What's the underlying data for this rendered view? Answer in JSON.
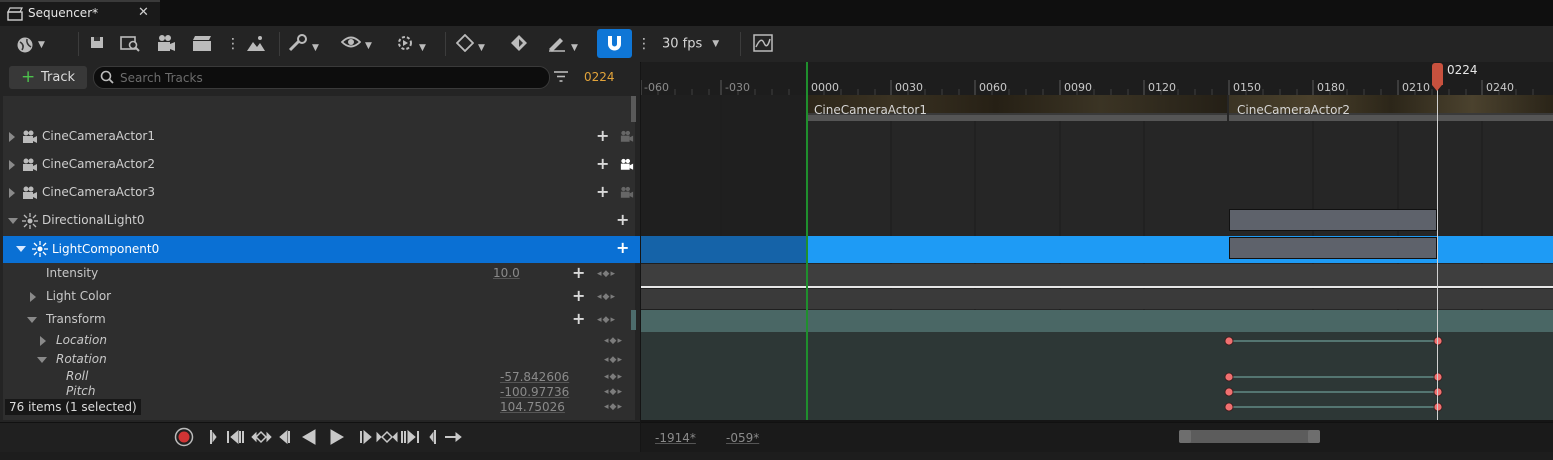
{
  "tab": {
    "title": "Sequencer*",
    "close": "✕"
  },
  "toolbar": {
    "fps": "30 fps"
  },
  "left": {
    "add_track_label": "Track",
    "search_placeholder": "Search Tracks",
    "current_frame": "0224",
    "rows": {
      "cam1": "CineCameraActor1",
      "cam2": "CineCameraActor2",
      "cam3": "CineCameraActor3",
      "dirlight": "DirectionalLight0",
      "lightcomp": "LightComponent0",
      "intensity": "Intensity",
      "intensity_value": "10.0",
      "lightcolor": "Light Color",
      "transform": "Transform",
      "location": "Location",
      "rotation": "Rotation",
      "roll": "Roll",
      "roll_value": "-57.842606",
      "pitch": "Pitch",
      "pitch_value": "-100.97736",
      "yaw_value": "104.75026"
    },
    "item_count": "76 items (1 selected)"
  },
  "ruler": {
    "ticks": [
      "-060",
      "-030",
      "0000",
      "0030",
      "0060",
      "0090",
      "0120",
      "0150",
      "0180",
      "0210",
      "0240"
    ],
    "playhead": "0224"
  },
  "shots": {
    "shot1": "CineCameraActor1",
    "shot2": "CineCameraActor2"
  },
  "bottom": {
    "view_start": "-1914*",
    "work_start": "-059*"
  },
  "colors": {
    "accent": "#0f76d6",
    "selected_row": "#0a70d4",
    "selected_track": "#1e9bf5",
    "frame": "#e2a33a",
    "key": "#f07070",
    "playhead": "#c8513e"
  }
}
